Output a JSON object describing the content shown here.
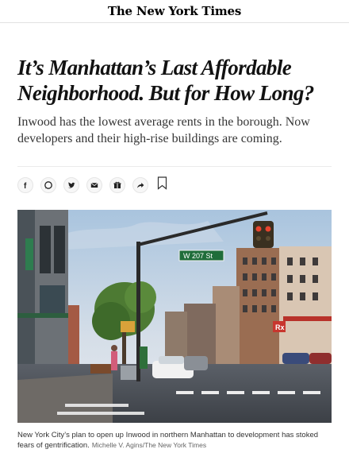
{
  "masthead": {
    "logo_text": "The New York Times"
  },
  "article": {
    "headline": "It’s Manhattan’s Last Affordable Neighborhood. But for How Long?",
    "summary": "Inwood has the lowest average rents in the borough. Now developers and their high-rise buildings are coming.",
    "share_buttons": [
      {
        "icon": "facebook-icon",
        "glyph": "f"
      },
      {
        "icon": "whatsapp-icon"
      },
      {
        "icon": "twitter-icon"
      },
      {
        "icon": "email-icon"
      },
      {
        "icon": "gift-icon"
      },
      {
        "icon": "share-icon"
      },
      {
        "icon": "bookmark-icon"
      }
    ],
    "photo": {
      "street_sign": "W 207 St",
      "store_sign": "Rx",
      "caption": "New York City’s plan to open up Inwood in northern Manhattan to development has stoked fears of gentrification.",
      "credit": "Michelle V. Agins/The New York Times"
    }
  },
  "colors": {
    "text": "#121212",
    "summary": "#363636",
    "rule": "#e2e2e2"
  }
}
